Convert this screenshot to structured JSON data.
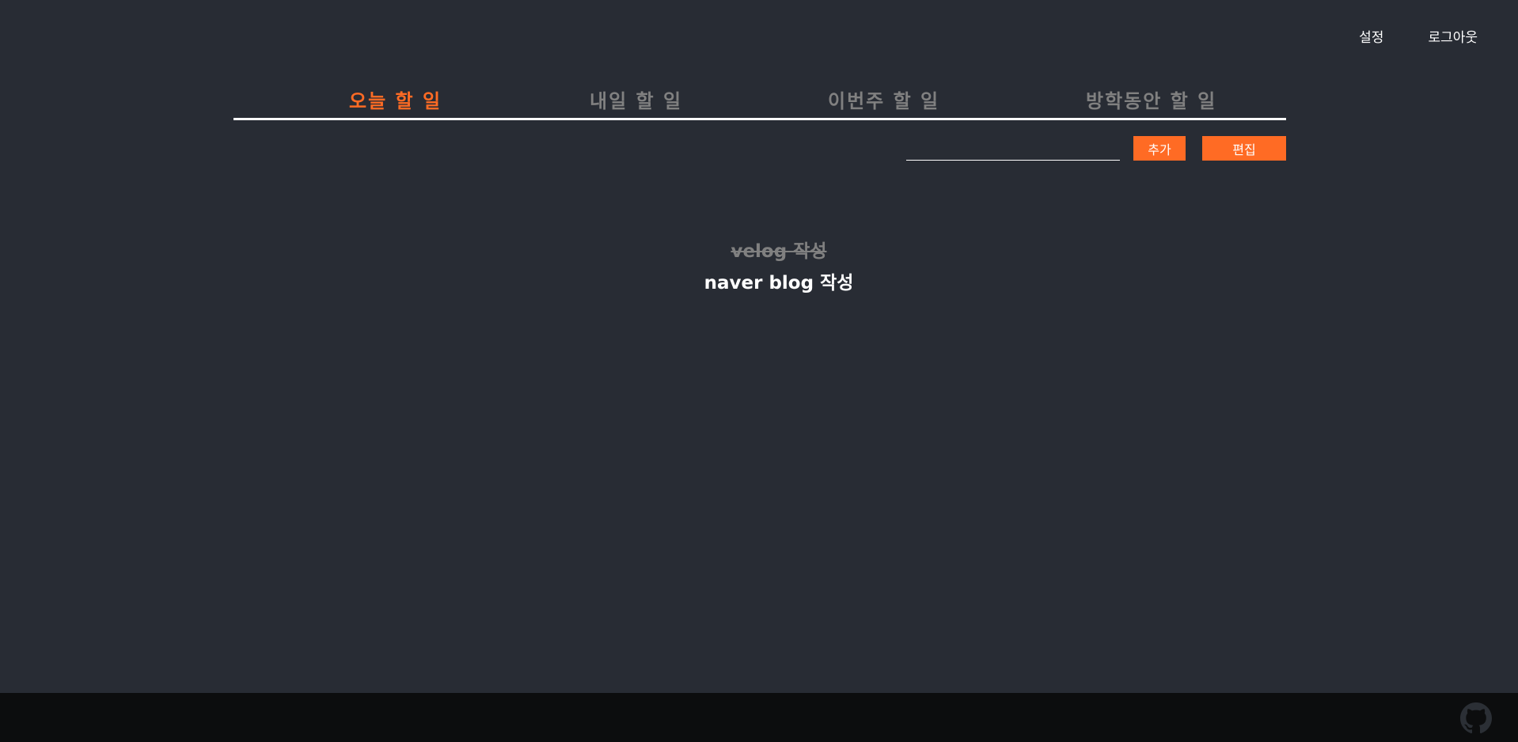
{
  "top_nav": {
    "settings_label": "설정",
    "logout_label": "로그아웃"
  },
  "tabs": [
    {
      "label": "오늘 할 일",
      "active": true
    },
    {
      "label": "내일 할 일",
      "active": false
    },
    {
      "label": "이번주 할 일",
      "active": false
    },
    {
      "label": "방학동안 할 일",
      "active": false
    }
  ],
  "input": {
    "value": "",
    "placeholder": ""
  },
  "buttons": {
    "add_label": "추가",
    "edit_label": "편집"
  },
  "todos": [
    {
      "text": "velog 작성",
      "done": true
    },
    {
      "text": "naver blog 작성",
      "done": false
    }
  ],
  "footer": {
    "icon": "github-icon"
  },
  "colors": {
    "background": "#282c34",
    "accent": "#ff6b24",
    "inactive_tab": "#808080",
    "footer": "#0c0d0e"
  }
}
